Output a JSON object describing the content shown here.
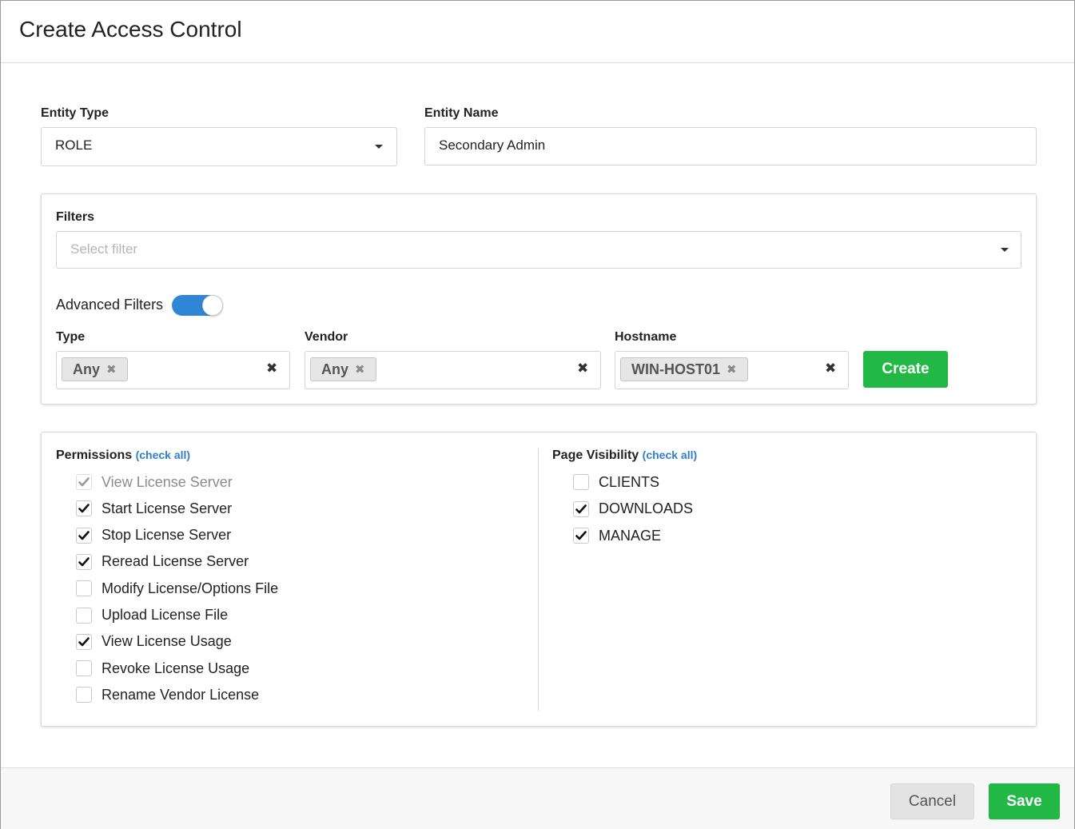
{
  "dialog": {
    "title": "Create Access Control"
  },
  "entity_type": {
    "label": "Entity Type",
    "value": "ROLE"
  },
  "entity_name": {
    "label": "Entity Name",
    "value": "Secondary Admin"
  },
  "filters": {
    "label": "Filters",
    "placeholder": "Select filter",
    "advanced_label": "Advanced Filters",
    "advanced_enabled": true,
    "type": {
      "label": "Type",
      "chip": "Any"
    },
    "vendor": {
      "label": "Vendor",
      "chip": "Any"
    },
    "hostname": {
      "label": "Hostname",
      "chip": "WIN-HOST01"
    },
    "create_label": "Create"
  },
  "permissions": {
    "title": "Permissions",
    "check_all": "(check all)",
    "items": [
      {
        "label": "View License Server",
        "checked": true,
        "disabled": true
      },
      {
        "label": "Start License Server",
        "checked": true,
        "disabled": false
      },
      {
        "label": "Stop License Server",
        "checked": true,
        "disabled": false
      },
      {
        "label": "Reread License Server",
        "checked": true,
        "disabled": false
      },
      {
        "label": "Modify License/Options File",
        "checked": false,
        "disabled": false
      },
      {
        "label": "Upload License File",
        "checked": false,
        "disabled": false
      },
      {
        "label": "View License Usage",
        "checked": true,
        "disabled": false
      },
      {
        "label": "Revoke License Usage",
        "checked": false,
        "disabled": false
      },
      {
        "label": "Rename Vendor License",
        "checked": false,
        "disabled": false
      }
    ]
  },
  "page_visibility": {
    "title": "Page Visibility",
    "check_all": "(check all)",
    "items": [
      {
        "label": "CLIENTS",
        "checked": false
      },
      {
        "label": "DOWNLOADS",
        "checked": true
      },
      {
        "label": "MANAGE",
        "checked": true
      }
    ]
  },
  "footer": {
    "cancel_label": "Cancel",
    "save_label": "Save"
  },
  "colors": {
    "primary_green": "#21b845",
    "toggle_blue": "#2f86d6",
    "link_blue": "#2f7fc9"
  }
}
